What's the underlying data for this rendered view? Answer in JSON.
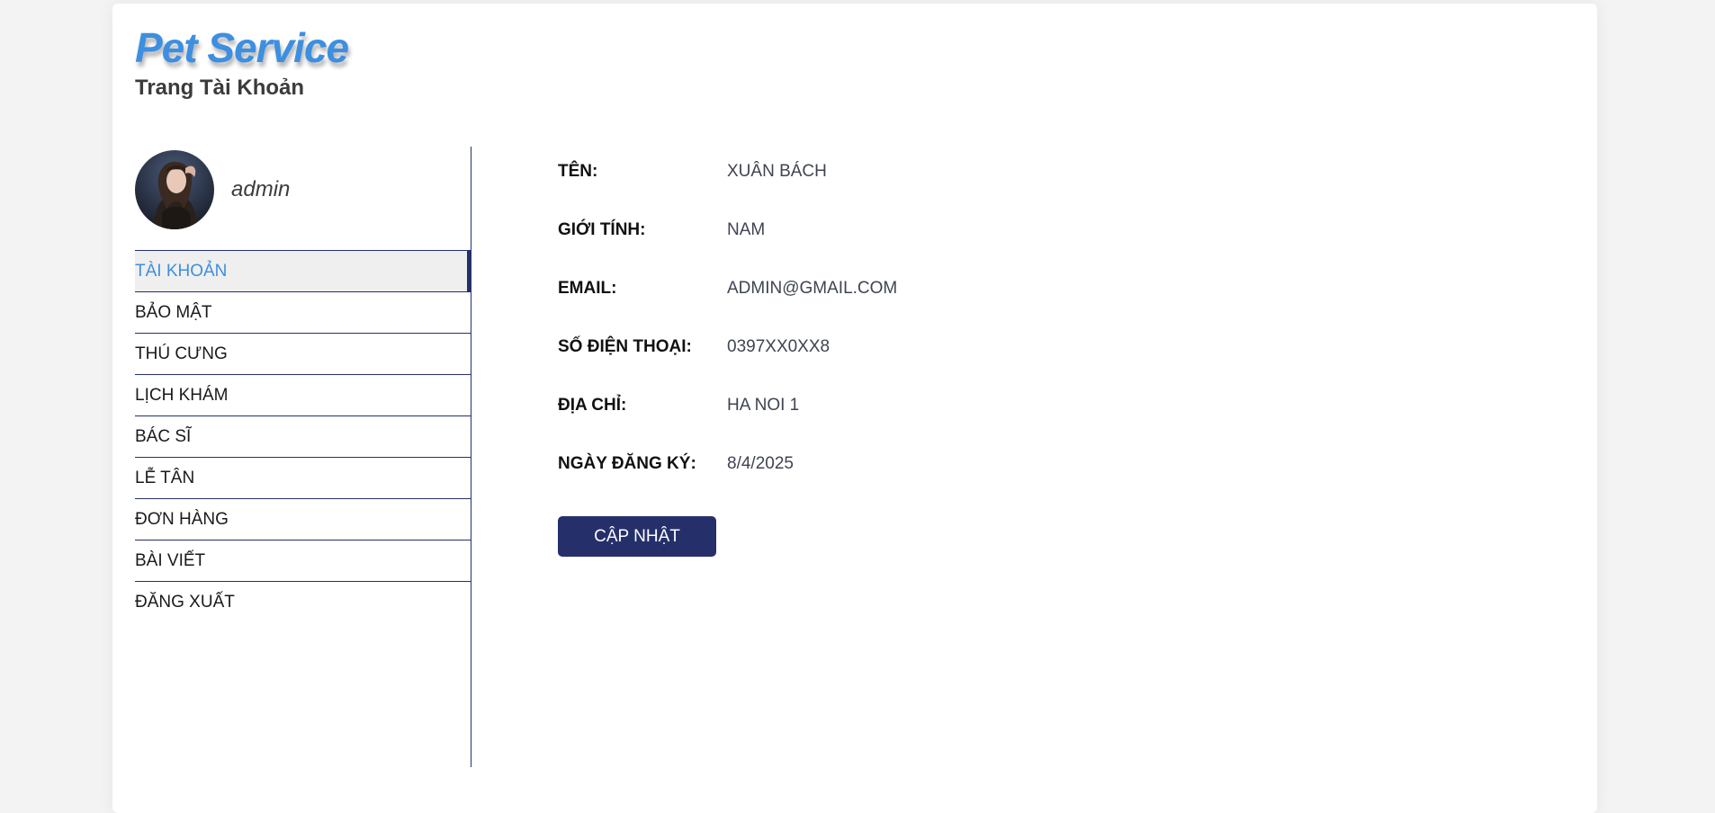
{
  "header": {
    "brand": "Pet Service",
    "subtitle": "Trang Tài Khoản"
  },
  "profile": {
    "username": "admin"
  },
  "sidebar": {
    "items": [
      {
        "label": "TÀI KHOẢN",
        "active": true
      },
      {
        "label": "BẢO MẬT"
      },
      {
        "label": "THÚ CƯNG"
      },
      {
        "label": "LỊCH KHÁM"
      },
      {
        "label": "BÁC SĨ"
      },
      {
        "label": "LỄ TÂN"
      },
      {
        "label": "ĐƠN HÀNG"
      },
      {
        "label": "BÀI VIẾT"
      },
      {
        "label": "ĐĂNG XUẤT"
      }
    ]
  },
  "account": {
    "fields": [
      {
        "label": "TÊN:",
        "value": "XUÂN BÁCH"
      },
      {
        "label": "GIỚI TÍNH:",
        "value": "NAM"
      },
      {
        "label": "EMAIL:",
        "value": "ADMIN@GMAIL.COM"
      },
      {
        "label": "SỐ ĐIỆN THOẠI:",
        "value": "0397XX0XX8"
      },
      {
        "label": "ĐỊA CHỈ:",
        "value": "HA NOI 1"
      },
      {
        "label": "NGÀY ĐĂNG KÝ:",
        "value": "8/4/2025"
      }
    ],
    "update_label": "CẬP NHẬT"
  },
  "colors": {
    "brand": "#3d8fe0",
    "primary": "#25306b",
    "active_background": "#efefef",
    "active_text": "#3d8fe0"
  }
}
